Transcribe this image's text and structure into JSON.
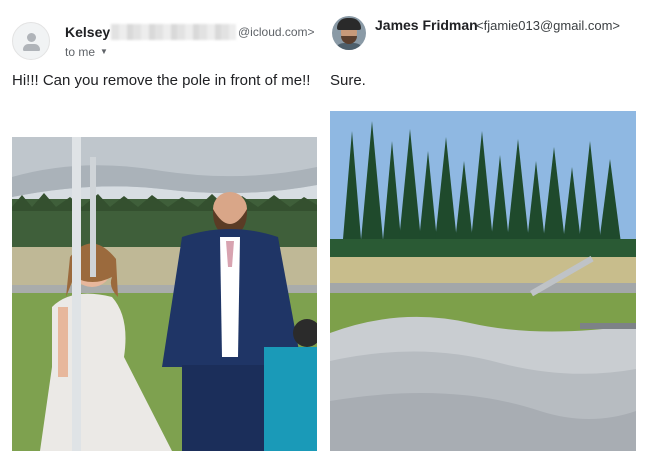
{
  "left_email": {
    "sender_name": "Kelsey",
    "sender_domain": "@icloud.com>",
    "recipient": "to me",
    "recipient_caret_icon": "chevron-down-icon",
    "message": "Hi!!! Can you remove the pole in front of me!!",
    "photo_icon": "wedding-photo-with-pole"
  },
  "right_email": {
    "sender_name": "James Fridman",
    "sender_email": "<fjamie013@gmail.com>",
    "message": "Sure.",
    "photo_icon": "collapsed-tent-on-grass"
  },
  "colors": {
    "text": "#202124",
    "secondary_text": "#5f6368"
  }
}
